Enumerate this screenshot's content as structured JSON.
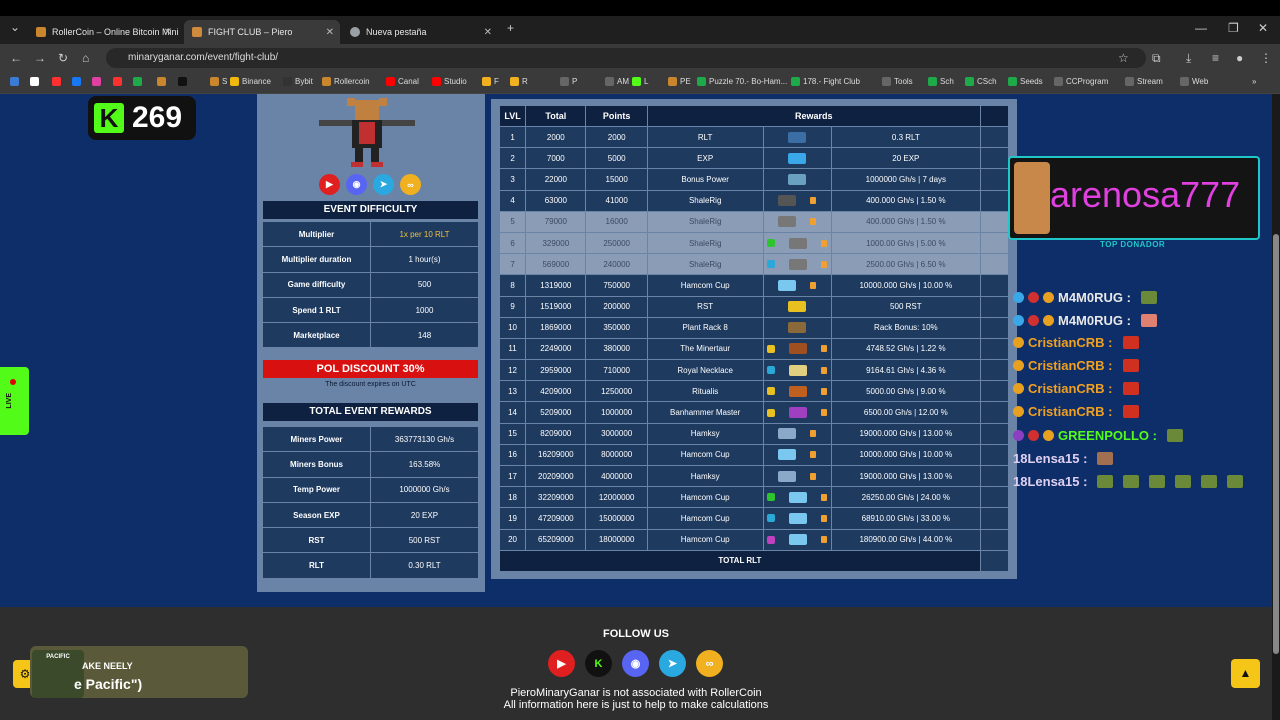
{
  "browser": {
    "tabs": [
      {
        "title": "RollerCoin – Online Bitcoin Mining",
        "color": "#c9862c"
      },
      {
        "title": "FIGHT CLUB – Piero",
        "color": "#d08a3c"
      },
      {
        "title": "Nueva pestaña",
        "color": "#9aa0a6"
      }
    ],
    "url": "minaryganar.com/event/fight-club/",
    "bookmarks": [
      {
        "label": "S",
        "color": "#c9862c"
      },
      {
        "label": "Binance",
        "color": "#f0b90b"
      },
      {
        "label": "Bybit",
        "color": "#333"
      },
      {
        "label": "Rollercoin",
        "color": "#c9862c"
      },
      {
        "label": "Canal",
        "color": "#ff0000"
      },
      {
        "label": "Studio",
        "color": "#ff0000"
      },
      {
        "label": "F",
        "color": "#f0b020"
      },
      {
        "label": "R",
        "color": "#f0b020"
      },
      {
        "label": "P",
        "color": "#666"
      },
      {
        "label": "AM",
        "color": "#666"
      },
      {
        "label": "L",
        "color": "#53fc18"
      },
      {
        "label": "PE",
        "color": "#c9862c"
      },
      {
        "label": "Puzzle 70.- Bo-Ham...",
        "color": "#1faa4a"
      },
      {
        "label": "178.- Fight Club",
        "color": "#1faa4a"
      },
      {
        "label": "Tools",
        "color": "#666"
      },
      {
        "label": "Sch",
        "color": "#1faa4a"
      },
      {
        "label": "CSch",
        "color": "#1faa4a"
      },
      {
        "label": "Seeds",
        "color": "#1faa4a"
      },
      {
        "label": "CCProgram",
        "color": "#666"
      },
      {
        "label": "Stream",
        "color": "#666"
      },
      {
        "label": "Web",
        "color": "#666"
      }
    ]
  },
  "kick": {
    "count": "269"
  },
  "difficulty": {
    "title": "EVENT DIFFICULTY",
    "rows": [
      {
        "k": "Multiplier",
        "v": "1x per 10 RLT"
      },
      {
        "k": "Multiplier duration",
        "v": "1 hour(s)"
      },
      {
        "k": "Game difficulty",
        "v": "500"
      },
      {
        "k": "Spend 1 RLT",
        "v": "1000"
      },
      {
        "k": "Marketplace",
        "v": "148"
      }
    ]
  },
  "discount": {
    "label": "POL DISCOUNT 30%",
    "note": "The discount expires on UTC"
  },
  "totals": {
    "title": "TOTAL EVENT REWARDS",
    "rows": [
      {
        "k": "Miners Power",
        "v": "363773130 Gh/s"
      },
      {
        "k": "Miners Bonus",
        "v": "163.58%"
      },
      {
        "k": "Temp Power",
        "v": "1000000 Gh/s"
      },
      {
        "k": "Season EXP",
        "v": "20 EXP"
      },
      {
        "k": "RST",
        "v": "500 RST"
      },
      {
        "k": "RLT",
        "v": "0.30 RLT"
      }
    ]
  },
  "rewards": {
    "headers": [
      "LVL",
      "Total",
      "Points",
      "Rewards"
    ],
    "total_label": "TOTAL RLT",
    "rows": [
      {
        "lvl": "1",
        "total": "2000",
        "points": "2000",
        "name": "RLT",
        "value": "0.3 RLT",
        "dim": false,
        "icon": "#3a6ea5",
        "lock": false,
        "tag": ""
      },
      {
        "lvl": "2",
        "total": "7000",
        "points": "5000",
        "name": "EXP",
        "value": "20 EXP",
        "dim": false,
        "icon": "#3aa8e8",
        "lock": false,
        "tag": ""
      },
      {
        "lvl": "3",
        "total": "22000",
        "points": "15000",
        "name": "Bonus Power",
        "value": "1000000 Gh/s | 7 days",
        "dim": false,
        "icon": "#6aa0c0",
        "lock": false,
        "tag": ""
      },
      {
        "lvl": "4",
        "total": "63000",
        "points": "41000",
        "name": "ShaleRig",
        "value": "400.000 Gh/s | 1.50 %",
        "dim": false,
        "icon": "#555",
        "lock": true,
        "tag": ""
      },
      {
        "lvl": "5",
        "total": "79000",
        "points": "16000",
        "name": "ShaleRig",
        "value": "400.000 Gh/s | 1.50 %",
        "dim": true,
        "icon": "#777",
        "lock": true,
        "tag": ""
      },
      {
        "lvl": "6",
        "total": "329000",
        "points": "250000",
        "name": "ShaleRig",
        "value": "1000.00 Gh/s | 5.00 %",
        "dim": true,
        "icon": "#777",
        "lock": true,
        "tag": "#2ec42e"
      },
      {
        "lvl": "7",
        "total": "569000",
        "points": "240000",
        "name": "ShaleRig",
        "value": "2500.00 Gh/s | 6.50 %",
        "dim": true,
        "icon": "#777",
        "lock": true,
        "tag": "#2aa8d8"
      },
      {
        "lvl": "8",
        "total": "1319000",
        "points": "750000",
        "name": "Hamcom Cup",
        "value": "10000.000 Gh/s | 10.00 %",
        "dim": false,
        "icon": "#7ac8f0",
        "lock": true,
        "tag": ""
      },
      {
        "lvl": "9",
        "total": "1519000",
        "points": "200000",
        "name": "RST",
        "value": "500 RST",
        "dim": false,
        "icon": "#e8c020",
        "lock": false,
        "tag": ""
      },
      {
        "lvl": "10",
        "total": "1869000",
        "points": "350000",
        "name": "Plant Rack 8",
        "value": "Rack Bonus: 10%",
        "dim": false,
        "icon": "#8a6a3a",
        "lock": false,
        "tag": ""
      },
      {
        "lvl": "11",
        "total": "2249000",
        "points": "380000",
        "name": "The Minertaur",
        "value": "4748.52 Gh/s | 1.22 %",
        "dim": false,
        "icon": "#a05020",
        "lock": true,
        "tag": "#e8c020"
      },
      {
        "lvl": "12",
        "total": "2959000",
        "points": "710000",
        "name": "Royal Necklace",
        "value": "9164.61 Gh/s | 4.36 %",
        "dim": false,
        "icon": "#e0d080",
        "lock": true,
        "tag": "#2aa8d8"
      },
      {
        "lvl": "13",
        "total": "4209000",
        "points": "1250000",
        "name": "Ritualis",
        "value": "5000.00 Gh/s | 9.00 %",
        "dim": false,
        "icon": "#c06020",
        "lock": true,
        "tag": "#e8c020"
      },
      {
        "lvl": "14",
        "total": "5209000",
        "points": "1000000",
        "name": "Banhammer Master",
        "value": "6500.00 Gh/s | 12.00 %",
        "dim": false,
        "icon": "#a040c0",
        "lock": true,
        "tag": "#e8c020"
      },
      {
        "lvl": "15",
        "total": "8209000",
        "points": "3000000",
        "name": "Hamksy",
        "value": "19000.000 Gh/s | 13.00 %",
        "dim": false,
        "icon": "#8aa8c8",
        "lock": true,
        "tag": ""
      },
      {
        "lvl": "16",
        "total": "16209000",
        "points": "8000000",
        "name": "Hamcom Cup",
        "value": "10000.000 Gh/s | 10.00 %",
        "dim": false,
        "icon": "#7ac8f0",
        "lock": true,
        "tag": ""
      },
      {
        "lvl": "17",
        "total": "20209000",
        "points": "4000000",
        "name": "Hamksy",
        "value": "19000.000 Gh/s | 13.00 %",
        "dim": false,
        "icon": "#8aa8c8",
        "lock": true,
        "tag": ""
      },
      {
        "lvl": "18",
        "total": "32209000",
        "points": "12000000",
        "name": "Hamcom Cup",
        "value": "26250.00 Gh/s | 24.00 %",
        "dim": false,
        "icon": "#7ac8f0",
        "lock": true,
        "tag": "#2ec42e"
      },
      {
        "lvl": "19",
        "total": "47209000",
        "points": "15000000",
        "name": "Hamcom Cup",
        "value": "68910.00 Gh/s | 33.00 %",
        "dim": false,
        "icon": "#7ac8f0",
        "lock": true,
        "tag": "#2aa8d8"
      },
      {
        "lvl": "20",
        "total": "65209000",
        "points": "18000000",
        "name": "Hamcom Cup",
        "value": "180900.00 Gh/s | 44.00 %",
        "dim": false,
        "icon": "#7ac8f0",
        "lock": true,
        "tag": "#c040c0"
      }
    ]
  },
  "donor": {
    "name": "arenosa777",
    "tag": "TOP DONADOR"
  },
  "chat": [
    {
      "user": "M4M0RUG :",
      "color": "#e8e8e8",
      "badges": [
        "#3aa8e8",
        "#d03030",
        "#e8a020"
      ],
      "emotes": [
        "#6a8a3a"
      ]
    },
    {
      "user": "M4M0RUG :",
      "color": "#e8e8e8",
      "badges": [
        "#3aa8e8",
        "#d03030",
        "#e8a020"
      ],
      "emotes": [
        "#e08070"
      ]
    },
    {
      "user": "CristianCRB :",
      "color": "#f0a020",
      "badges": [
        "#e8a020"
      ],
      "emotes": [
        "#d03020"
      ]
    },
    {
      "user": "CristianCRB :",
      "color": "#f0a020",
      "badges": [
        "#e8a020"
      ],
      "emotes": [
        "#d03020"
      ]
    },
    {
      "user": "CristianCRB :",
      "color": "#f0a020",
      "badges": [
        "#e8a020"
      ],
      "emotes": [
        "#d03020"
      ]
    },
    {
      "user": "CristianCRB :",
      "color": "#f0a020",
      "badges": [
        "#e8a020"
      ],
      "emotes": [
        "#d03020"
      ]
    },
    {
      "user": "GREENPOLLO :",
      "color": "#53fc18",
      "badges": [
        "#8a40c0",
        "#d03030",
        "#e8a020"
      ],
      "emotes": [
        "#6a8a3a"
      ]
    },
    {
      "user": "18Lensa15 :",
      "color": "#e0d0f0",
      "badges": [],
      "emotes": [
        "#a07050"
      ]
    },
    {
      "user": "18Lensa15 :",
      "color": "#e0d0f0",
      "badges": [],
      "emotes": [
        "#6a8a3a",
        "#6a8a3a",
        "#6a8a3a",
        "#6a8a3a",
        "#6a8a3a",
        "#6a8a3a"
      ]
    }
  ],
  "live_tab": {
    "label": "LIVE"
  },
  "footer": {
    "follow": "FOLLOW US",
    "disclaimer": "PieroMinaryGanar is not associated with RollerCoin",
    "disclaimer2": "All information here is just to help to make calculations"
  },
  "overlay": {
    "line1": "AKE NEELY",
    "line2": "e Pacific\")",
    "thumb": "PACIFIC"
  }
}
